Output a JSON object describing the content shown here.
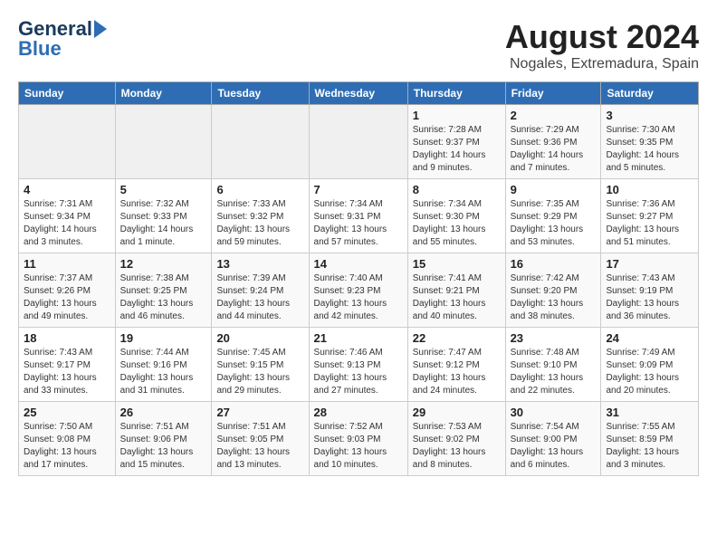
{
  "header": {
    "logo_line1": "General",
    "logo_line2": "Blue",
    "title": "August 2024",
    "subtitle": "Nogales, Extremadura, Spain"
  },
  "weekdays": [
    "Sunday",
    "Monday",
    "Tuesday",
    "Wednesday",
    "Thursday",
    "Friday",
    "Saturday"
  ],
  "weeks": [
    [
      {
        "day": "",
        "info": ""
      },
      {
        "day": "",
        "info": ""
      },
      {
        "day": "",
        "info": ""
      },
      {
        "day": "",
        "info": ""
      },
      {
        "day": "1",
        "info": "Sunrise: 7:28 AM\nSunset: 9:37 PM\nDaylight: 14 hours and 9 minutes."
      },
      {
        "day": "2",
        "info": "Sunrise: 7:29 AM\nSunset: 9:36 PM\nDaylight: 14 hours and 7 minutes."
      },
      {
        "day": "3",
        "info": "Sunrise: 7:30 AM\nSunset: 9:35 PM\nDaylight: 14 hours and 5 minutes."
      }
    ],
    [
      {
        "day": "4",
        "info": "Sunrise: 7:31 AM\nSunset: 9:34 PM\nDaylight: 14 hours and 3 minutes."
      },
      {
        "day": "5",
        "info": "Sunrise: 7:32 AM\nSunset: 9:33 PM\nDaylight: 14 hours and 1 minute."
      },
      {
        "day": "6",
        "info": "Sunrise: 7:33 AM\nSunset: 9:32 PM\nDaylight: 13 hours and 59 minutes."
      },
      {
        "day": "7",
        "info": "Sunrise: 7:34 AM\nSunset: 9:31 PM\nDaylight: 13 hours and 57 minutes."
      },
      {
        "day": "8",
        "info": "Sunrise: 7:34 AM\nSunset: 9:30 PM\nDaylight: 13 hours and 55 minutes."
      },
      {
        "day": "9",
        "info": "Sunrise: 7:35 AM\nSunset: 9:29 PM\nDaylight: 13 hours and 53 minutes."
      },
      {
        "day": "10",
        "info": "Sunrise: 7:36 AM\nSunset: 9:27 PM\nDaylight: 13 hours and 51 minutes."
      }
    ],
    [
      {
        "day": "11",
        "info": "Sunrise: 7:37 AM\nSunset: 9:26 PM\nDaylight: 13 hours and 49 minutes."
      },
      {
        "day": "12",
        "info": "Sunrise: 7:38 AM\nSunset: 9:25 PM\nDaylight: 13 hours and 46 minutes."
      },
      {
        "day": "13",
        "info": "Sunrise: 7:39 AM\nSunset: 9:24 PM\nDaylight: 13 hours and 44 minutes."
      },
      {
        "day": "14",
        "info": "Sunrise: 7:40 AM\nSunset: 9:23 PM\nDaylight: 13 hours and 42 minutes."
      },
      {
        "day": "15",
        "info": "Sunrise: 7:41 AM\nSunset: 9:21 PM\nDaylight: 13 hours and 40 minutes."
      },
      {
        "day": "16",
        "info": "Sunrise: 7:42 AM\nSunset: 9:20 PM\nDaylight: 13 hours and 38 minutes."
      },
      {
        "day": "17",
        "info": "Sunrise: 7:43 AM\nSunset: 9:19 PM\nDaylight: 13 hours and 36 minutes."
      }
    ],
    [
      {
        "day": "18",
        "info": "Sunrise: 7:43 AM\nSunset: 9:17 PM\nDaylight: 13 hours and 33 minutes."
      },
      {
        "day": "19",
        "info": "Sunrise: 7:44 AM\nSunset: 9:16 PM\nDaylight: 13 hours and 31 minutes."
      },
      {
        "day": "20",
        "info": "Sunrise: 7:45 AM\nSunset: 9:15 PM\nDaylight: 13 hours and 29 minutes."
      },
      {
        "day": "21",
        "info": "Sunrise: 7:46 AM\nSunset: 9:13 PM\nDaylight: 13 hours and 27 minutes."
      },
      {
        "day": "22",
        "info": "Sunrise: 7:47 AM\nSunset: 9:12 PM\nDaylight: 13 hours and 24 minutes."
      },
      {
        "day": "23",
        "info": "Sunrise: 7:48 AM\nSunset: 9:10 PM\nDaylight: 13 hours and 22 minutes."
      },
      {
        "day": "24",
        "info": "Sunrise: 7:49 AM\nSunset: 9:09 PM\nDaylight: 13 hours and 20 minutes."
      }
    ],
    [
      {
        "day": "25",
        "info": "Sunrise: 7:50 AM\nSunset: 9:08 PM\nDaylight: 13 hours and 17 minutes."
      },
      {
        "day": "26",
        "info": "Sunrise: 7:51 AM\nSunset: 9:06 PM\nDaylight: 13 hours and 15 minutes."
      },
      {
        "day": "27",
        "info": "Sunrise: 7:51 AM\nSunset: 9:05 PM\nDaylight: 13 hours and 13 minutes."
      },
      {
        "day": "28",
        "info": "Sunrise: 7:52 AM\nSunset: 9:03 PM\nDaylight: 13 hours and 10 minutes."
      },
      {
        "day": "29",
        "info": "Sunrise: 7:53 AM\nSunset: 9:02 PM\nDaylight: 13 hours and 8 minutes."
      },
      {
        "day": "30",
        "info": "Sunrise: 7:54 AM\nSunset: 9:00 PM\nDaylight: 13 hours and 6 minutes."
      },
      {
        "day": "31",
        "info": "Sunrise: 7:55 AM\nSunset: 8:59 PM\nDaylight: 13 hours and 3 minutes."
      }
    ]
  ]
}
